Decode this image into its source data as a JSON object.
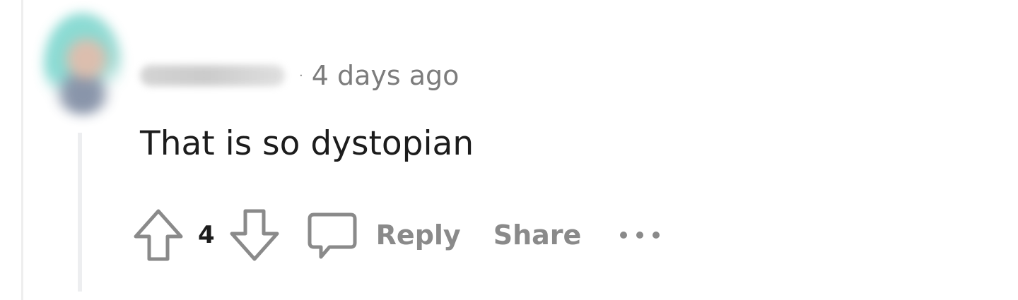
{
  "comment": {
    "timestamp": "4 days ago",
    "text": "That is so dystopian",
    "score": "4"
  },
  "actions": {
    "upvote_icon": "arrow-up-icon",
    "downvote_icon": "arrow-down-icon",
    "comment_icon": "speech-bubble-icon",
    "reply_label": "Reply",
    "share_label": "Share",
    "more_icon": "ellipsis-icon"
  },
  "colors": {
    "text_primary": "#1c1c1c",
    "text_secondary": "#7c7c7c",
    "action_gray": "#8a8a8a",
    "thread_line": "#edeef0"
  }
}
